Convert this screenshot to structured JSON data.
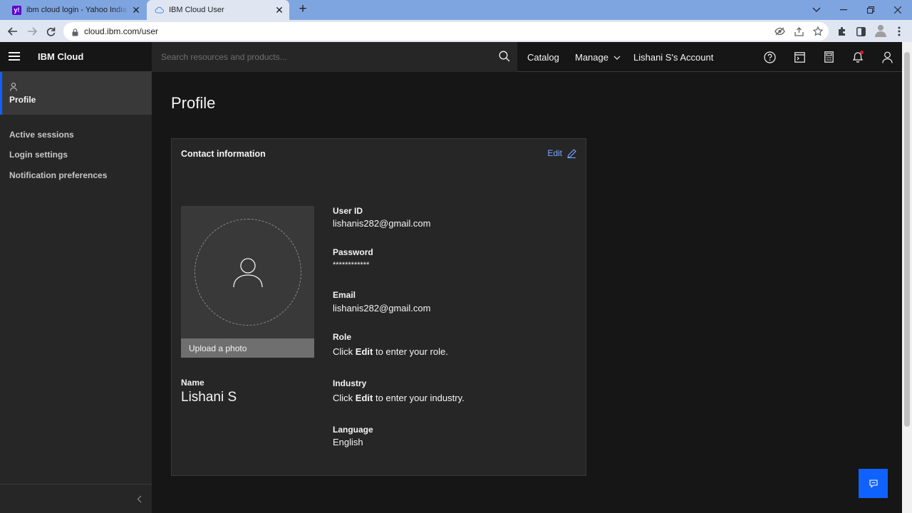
{
  "browser": {
    "tabs": [
      {
        "title": "ibm cloud login - Yahoo India Se",
        "favicon": "yahoo-icon",
        "active": false
      },
      {
        "title": "IBM Cloud User",
        "favicon": "cloud-icon",
        "active": true
      }
    ],
    "url": "cloud.ibm.com/user"
  },
  "header": {
    "brand": "IBM Cloud",
    "search_placeholder": "Search resources and products...",
    "nav": {
      "catalog": "Catalog",
      "manage": "Manage",
      "account": "Lishani S's Account"
    },
    "notification_dot_color": "#da1e28"
  },
  "sidebar": {
    "active_item": "Profile",
    "items": [
      "Active sessions",
      "Login settings",
      "Notification preferences"
    ]
  },
  "main": {
    "title": "Profile",
    "card": {
      "title": "Contact information",
      "edit_label": "Edit",
      "upload_label": "Upload a photo",
      "name_label": "Name",
      "name_value": "Lishani S",
      "fields": {
        "user_id": {
          "label": "User ID",
          "value": "lishanis282@gmail.com"
        },
        "password": {
          "label": "Password",
          "value": "************"
        },
        "email": {
          "label": "Email",
          "value": "lishanis282@gmail.com"
        },
        "role": {
          "label": "Role",
          "prefix": "Click ",
          "bold": "Edit",
          "suffix": " to enter your role."
        },
        "industry": {
          "label": "Industry",
          "prefix": "Click ",
          "bold": "Edit",
          "suffix": " to enter your industry."
        },
        "language": {
          "label": "Language",
          "value": "English"
        }
      }
    }
  },
  "colors": {
    "accent": "#0f62fe",
    "link": "#78a9ff",
    "background": "#161616",
    "panel": "#262626"
  }
}
